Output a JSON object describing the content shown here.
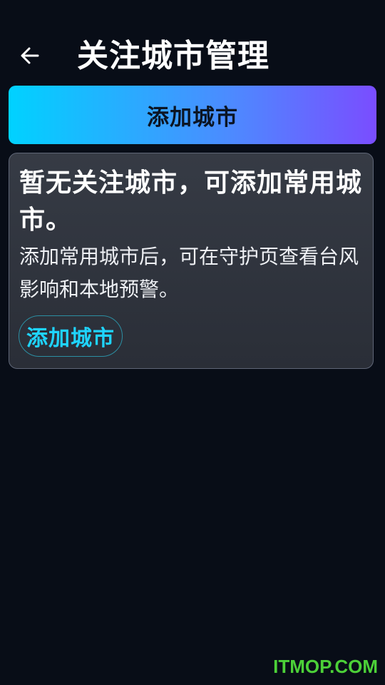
{
  "header": {
    "back_icon": "arrow-left-icon",
    "title": "关注城市管理"
  },
  "add_city_button": {
    "label": "添加城市"
  },
  "empty_state": {
    "title": "暂无关注城市，可添加常用城市。",
    "description": "添加常用城市后，可在守护页查看台风影响和本地预警。",
    "button_label": "添加城市"
  },
  "watermark": "ITMOP.COM",
  "colors": {
    "background": "#080d17",
    "gradient_start": "#00d2ff",
    "gradient_end": "#7a4dff",
    "accent_text": "#1fd4ff",
    "watermark": "#4cd038"
  }
}
